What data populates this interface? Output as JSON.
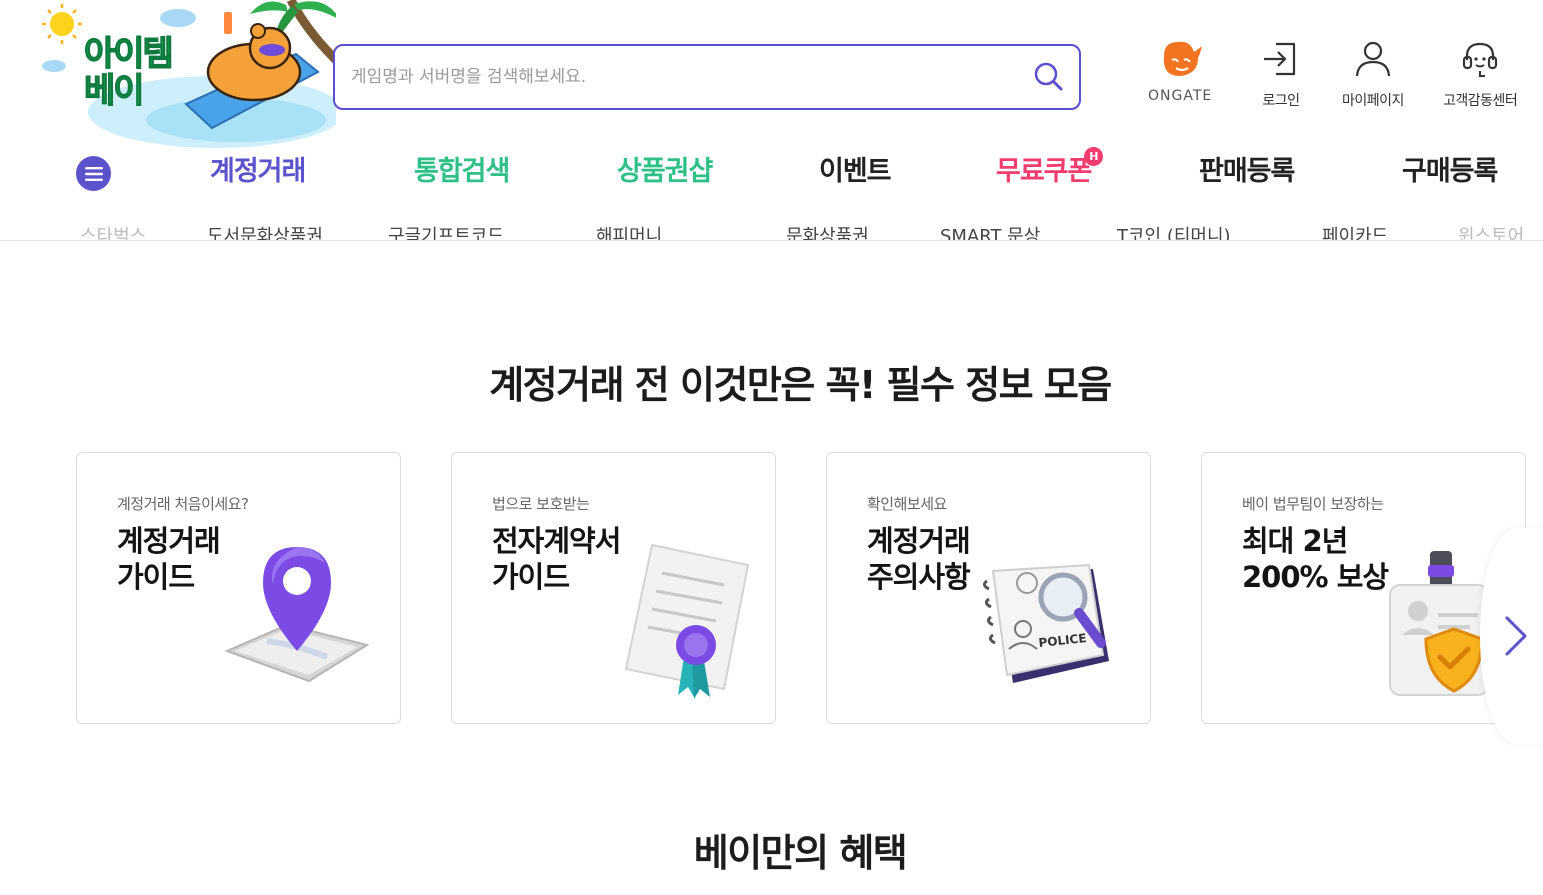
{
  "header": {
    "logo_text_line1": "아이템",
    "logo_text_line2": "베이",
    "search_placeholder": "게임명과 서버명을 검색해보세요.",
    "util": [
      {
        "label": "ONGATE",
        "icon": "ongate-logo-icon"
      },
      {
        "label": "로그인",
        "icon": "login-icon"
      },
      {
        "label": "마이페이지",
        "icon": "user-icon"
      },
      {
        "label": "고객감동센터",
        "icon": "headset-icon"
      }
    ]
  },
  "nav": {
    "items": [
      {
        "label": "계정거래",
        "color": "#5b52cc"
      },
      {
        "label": "통합검색",
        "color": "#2fc08a"
      },
      {
        "label": "상품권샵",
        "color": "#2fc08a"
      },
      {
        "label": "이벤트",
        "color": "#222222"
      },
      {
        "label": "무료쿠폰",
        "color": "#f03c6e",
        "badge": "H"
      },
      {
        "label": "판매등록",
        "color": "#222222"
      },
      {
        "label": "구매등록",
        "color": "#222222"
      }
    ]
  },
  "ticker": [
    "스타벅스",
    "도서문화상품권",
    "구글기프트코드",
    "해피머니",
    "문화상품권",
    "SMART 문상",
    "T코인 (티머니)",
    "페이카드",
    "윈스토어"
  ],
  "section_info": {
    "title": "계정거래 전 이것만은 꼭! 필수 정보 모음",
    "cards": [
      {
        "subtitle": "계정거래 처음이세요?",
        "title": "계정거래\n가이드",
        "icon": "map-pin-icon"
      },
      {
        "subtitle": "법으로 보호받는",
        "title": "전자계약서\n가이드",
        "icon": "certificate-icon"
      },
      {
        "subtitle": "확인해보세요",
        "title": "계정거래\n주의사항",
        "icon": "police-notebook-icon",
        "art_text": "POLICE"
      },
      {
        "subtitle": "베이 법무팀이 보장하는",
        "title": "최대 2년\n200% 보상",
        "icon": "shield-badge-icon"
      }
    ]
  },
  "section_benefit": {
    "title": "베이만의 혜택"
  }
}
